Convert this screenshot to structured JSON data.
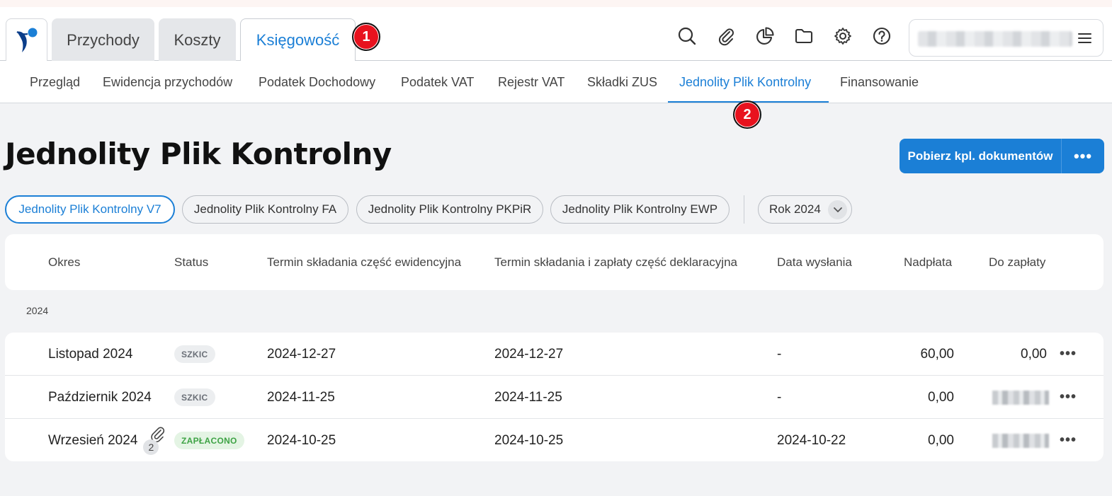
{
  "app": {
    "top_tabs": [
      {
        "label": "Przychody"
      },
      {
        "label": "Koszty"
      },
      {
        "label": "Księgowość"
      }
    ],
    "top_icons": [
      "search-icon",
      "paperclip-icon",
      "pie-chart-icon",
      "folder-icon",
      "gear-icon",
      "help-icon"
    ],
    "annotations": [
      "1",
      "2"
    ]
  },
  "subnav": {
    "items": [
      {
        "label": "Przegląd"
      },
      {
        "label": "Ewidencja przychodów"
      },
      {
        "label": "Podatek Dochodowy"
      },
      {
        "label": "Podatek VAT"
      },
      {
        "label": "Rejestr VAT"
      },
      {
        "label": "Składki ZUS"
      },
      {
        "label": "Jednolity Plik Kontrolny"
      },
      {
        "label": "Finansowanie"
      }
    ],
    "active_index": 6
  },
  "page": {
    "title": "Jednolity Plik Kontrolny",
    "download_button": "Pobierz kpl. dokumentów",
    "more_button": "•••"
  },
  "filters": {
    "chips": [
      {
        "label": "Jednolity Plik Kontrolny V7",
        "active": true
      },
      {
        "label": "Jednolity Plik Kontrolny FA",
        "active": false
      },
      {
        "label": "Jednolity Plik Kontrolny PKPiR",
        "active": false
      },
      {
        "label": "Jednolity Plik Kontrolny EWP",
        "active": false
      }
    ],
    "year": "Rok 2024"
  },
  "table": {
    "columns": [
      "Okres",
      "Status",
      "Termin składania część ewidencyjna",
      "Termin składania i zapłaty część deklaracyjna",
      "Data wysłania",
      "Nadpłata",
      "Do zapłaty"
    ],
    "group": "2024",
    "rows": [
      {
        "period": "Listopad 2024",
        "status": "SZKIC",
        "term_ewid": "2024-12-27",
        "term_dekl": "2024-12-27",
        "sent": "-",
        "overpay": "60,00",
        "due": "0,00"
      },
      {
        "period": "Październik 2024",
        "status": "SZKIC",
        "term_ewid": "2024-11-25",
        "term_dekl": "2024-11-25",
        "sent": "-",
        "overpay": "0,00",
        "due": ""
      },
      {
        "period": "Wrzesień 2024",
        "attachments": "2",
        "status": "ZAPŁACONO",
        "term_ewid": "2024-10-25",
        "term_dekl": "2024-10-25",
        "sent": "2024-10-22",
        "overpay": "0,00",
        "due": ""
      }
    ],
    "row_menu": "•••"
  },
  "colors": {
    "accent": "#1b7fd6",
    "badge": "#e8121e",
    "paid": "#3ea345"
  }
}
